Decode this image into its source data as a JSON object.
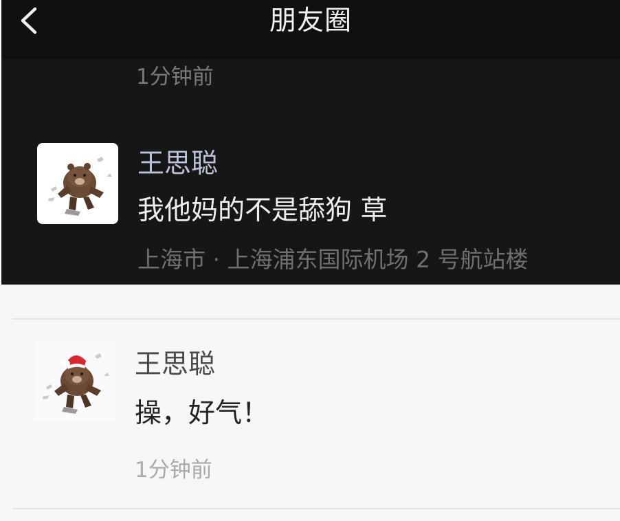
{
  "header": {
    "title": "朋友圈",
    "back_icon": "chevron-left-icon"
  },
  "dark_section": {
    "previous_time": "1分钟前",
    "comment": {
      "avatar_icon": "brown-bear-sticker-avatar",
      "name": "王思聪",
      "text": "我他妈的不是舔狗 草",
      "location": "上海市 · 上海浦东国际机场 2 号航站楼"
    }
  },
  "light_section": {
    "comment": {
      "avatar_icon": "brown-bear-santa-hat-avatar",
      "name": "王思聪",
      "text": "操，好气！",
      "time": "1分钟前"
    }
  },
  "colors": {
    "dark_background": "#161616",
    "dark_name": "#bcc0d8",
    "light_background": "#f7f7fa"
  }
}
